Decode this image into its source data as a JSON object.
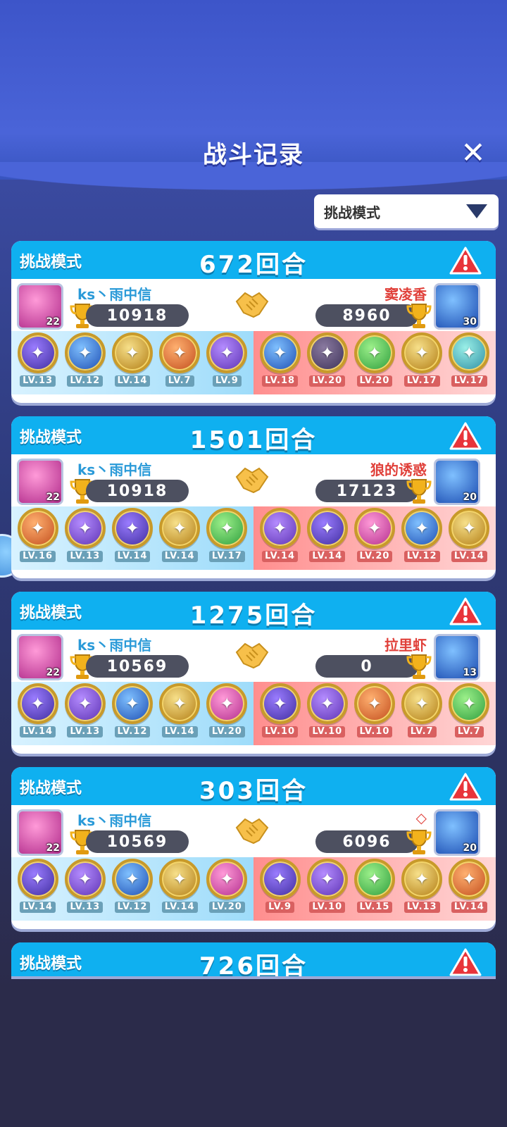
{
  "header": {
    "title": "战斗记录",
    "close_icon": "close-icon"
  },
  "filter": {
    "selected": "挑战模式",
    "icon": "chevron-down-icon"
  },
  "cards": [
    {
      "mode": "挑战模式",
      "rounds": "672回合",
      "left": {
        "name": "ks丶雨中信",
        "score": "10918",
        "level": "22"
      },
      "right": {
        "name": "窦凌香",
        "score": "8960",
        "level": "30"
      },
      "left_units": [
        "LV.13",
        "LV.12",
        "LV.14",
        "LV.7",
        "LV.9"
      ],
      "right_units": [
        "LV.18",
        "LV.20",
        "LV.20",
        "LV.17",
        "LV.17"
      ]
    },
    {
      "mode": "挑战模式",
      "rounds": "1501回合",
      "left": {
        "name": "ks丶雨中信",
        "score": "10918",
        "level": "22"
      },
      "right": {
        "name": "狼的诱惑",
        "score": "17123",
        "level": "20"
      },
      "left_units": [
        "LV.16",
        "LV.13",
        "LV.14",
        "LV.14",
        "LV.17"
      ],
      "right_units": [
        "LV.14",
        "LV.14",
        "LV.20",
        "LV.12",
        "LV.14"
      ]
    },
    {
      "mode": "挑战模式",
      "rounds": "1275回合",
      "left": {
        "name": "ks丶雨中信",
        "score": "10569",
        "level": "22"
      },
      "right": {
        "name": "拉里虾",
        "score": "0",
        "level": "13"
      },
      "left_units": [
        "LV.14",
        "LV.13",
        "LV.12",
        "LV.14",
        "LV.20"
      ],
      "right_units": [
        "LV.10",
        "LV.10",
        "LV.10",
        "LV.7",
        "LV.7"
      ]
    },
    {
      "mode": "挑战模式",
      "rounds": "303回合",
      "left": {
        "name": "ks丶雨中信",
        "score": "10569",
        "level": "22"
      },
      "right": {
        "name": "◇",
        "score": "6096",
        "level": "20"
      },
      "left_units": [
        "LV.14",
        "LV.13",
        "LV.12",
        "LV.14",
        "LV.20"
      ],
      "right_units": [
        "LV.9",
        "LV.10",
        "LV.15",
        "LV.13",
        "LV.14"
      ]
    },
    {
      "mode": "挑战模式",
      "rounds": "726回合"
    }
  ]
}
